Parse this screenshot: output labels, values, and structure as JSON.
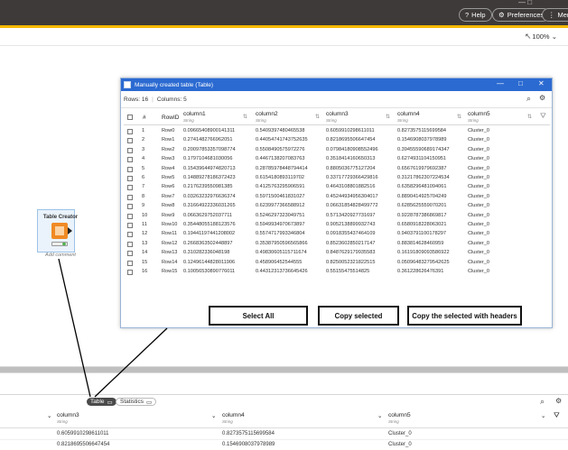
{
  "topbar": {
    "help_label": "Help",
    "preferences_label": "Preferences",
    "menu_label": "Menu",
    "window_controls": "— □"
  },
  "toolbar": {
    "zoom_label": "100%",
    "zoom_chevron": "⌄",
    "pointer_icon": "↖",
    "cursor_icon": "pointer-icon"
  },
  "node": {
    "title": "Table Creator",
    "comment": "Add comment",
    "color": "#f08a24"
  },
  "dialog": {
    "title": "Manually created table (Table)",
    "rows_info": "Rows: 16",
    "columns_info": "Columns: 5",
    "minimize": "—",
    "maximize": "□",
    "close": "✕",
    "search_icon": "⌕",
    "settings_icon": "⚙",
    "filter_icon": "⛛",
    "sort_icon": "⇅",
    "headers": [
      "#",
      "RowID",
      "column1",
      "column2",
      "column3",
      "column4",
      "column5"
    ],
    "header_types": [
      "String",
      "String",
      "String",
      "String",
      "String"
    ],
    "rows": [
      {
        "n": "1",
        "id": "Row0",
        "c1": "0.09665408900141311",
        "c2": "0.5409397480465538",
        "c3": "0.6059910298611011",
        "c4": "0.8273575115699584",
        "c5": "Cluster_0"
      },
      {
        "n": "2",
        "id": "Row1",
        "c1": "0.2741482766962051",
        "c2": "0.44054741743752635",
        "c3": "0.8218695506647454",
        "c4": "0.1546908037978989",
        "c5": "Cluster_0"
      },
      {
        "n": "3",
        "id": "Row2",
        "c1": "0.20097853357098774",
        "c2": "0.5508490575972276",
        "c3": "0.07984180908552496",
        "c4": "0.39455590689174347",
        "c5": "Cluster_0"
      },
      {
        "n": "4",
        "id": "Row3",
        "c1": "0.1797104681030056",
        "c2": "0.4467138207083763",
        "c3": "0.3518414160650313",
        "c4": "0.6274931104150951",
        "c5": "Cluster_0"
      },
      {
        "n": "5",
        "id": "Row4",
        "c1": "0.1543964497482071​3",
        "c2": "0.2878597844879441​4",
        "c3": "0.8805036775127204",
        "c4": "0.6567619979692387",
        "c5": "Cluster_0"
      },
      {
        "n": "6",
        "id": "Row5",
        "c1": "0.14889278186372423",
        "c2": "0.6154180893119702",
        "c3": "0.33717729366429816",
        "c4": "0.31217862307224534",
        "c5": "Cluster_0"
      },
      {
        "n": "7",
        "id": "Row6",
        "c1": "0.2176239550981385",
        "c2": "0.4125763295906591",
        "c3": "0.4643108801882516",
        "c4": "0.6358296481094061",
        "c5": "Cluster_0"
      },
      {
        "n": "8",
        "id": "Row7",
        "c1": "0.03263232976636374",
        "c2": "0.5971500461831027",
        "c3": "0.45244934956304017",
        "c4": "0.8890414925704249",
        "c5": "Cluster_0"
      },
      {
        "n": "9",
        "id": "Row8",
        "c1": "0.31664922336031265",
        "c2": "0.6239977366588912",
        "c3": "0.06631854828499772",
        "c4": "0.6285625559070201",
        "c5": "Cluster_0"
      },
      {
        "n": "10",
        "id": "Row9",
        "c1": "0.0663629752037711",
        "c2": "0.5246297323049751",
        "c3": "0.5713420927731697",
        "c4": "0.9228787386869817",
        "c5": "Cluster_0"
      },
      {
        "n": "11",
        "id": "Row10",
        "c1": "0.35448055188123576",
        "c2": "0.5949934970673897",
        "c3": "0.9052138899932743",
        "c4": "0.6580918228063021",
        "c5": "Cluster_0"
      },
      {
        "n": "12",
        "id": "Row11",
        "c1": "0.1944119744120800​2",
        "c2": "0.5574717993346804",
        "c3": "0.0918355437464109",
        "c4": "0.9403791100178297",
        "c5": "Cluster_0"
      },
      {
        "n": "13",
        "id": "Row12",
        "c1": "0.2668363502448897",
        "c2": "0.35387950596565866",
        "c3": "0.8523602850217147",
        "c4": "0.883814628460959",
        "c5": "Cluster_0"
      },
      {
        "n": "14",
        "id": "Row13",
        "c1": "0.3102823360481​98",
        "c2": "0.49830605115711674",
        "c3": "0.8487629179935583",
        "c4": "0.16191809093586922",
        "c5": "Cluster_0"
      },
      {
        "n": "15",
        "id": "Row14",
        "c1": "0.12496144828011906",
        "c2": "0.458906452544555",
        "c3": "0.8250052321822515",
        "c4": "0.05096483279542625",
        "c5": "Cluster_0"
      },
      {
        "n": "16",
        "id": "Row15",
        "c1": "0.10056530890776011",
        "c2": "0.44312313736645426",
        "c3": "0.5515547551482​5",
        "c4": "0.361228626476391",
        "c5": "Cluster_0"
      }
    ]
  },
  "buttons": {
    "select_all": "Select All",
    "copy_selected": "Copy selected",
    "copy_with_headers": "Copy the selected with headers"
  },
  "panel": {
    "tab_table": "Table",
    "tab_statistics": "Statistics",
    "search_icon": "⌕",
    "settings_icon": "⚙",
    "filter_icon": "⛛",
    "headers": [
      "column3",
      "column4",
      "column5"
    ],
    "header_types": [
      "String",
      "String",
      "String"
    ],
    "rows": [
      {
        "c3": "0.6059910298611011",
        "c4": "0.8273575115699584",
        "c5": "Cluster_0"
      },
      {
        "c3": "0.8218695506647454",
        "c4": "0.1546908037978989",
        "c5": "Cluster_0"
      }
    ]
  },
  "colors": {
    "title_bar": "#3e3a39",
    "accent": "#f5b800",
    "dialog_title": "#2b6ad1"
  }
}
